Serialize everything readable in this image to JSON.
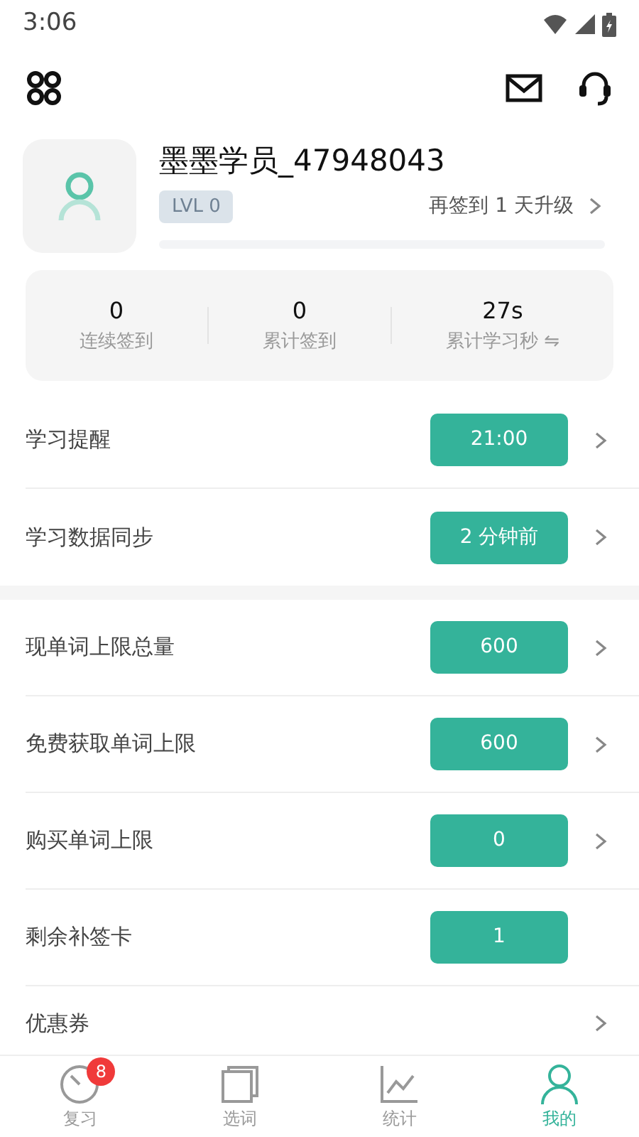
{
  "status_bar": {
    "time": "3:06"
  },
  "profile": {
    "username": "墨墨学员_47948043",
    "level_badge": "LVL 0",
    "upgrade_hint": "再签到 1 天升级"
  },
  "stats": [
    {
      "value": "0",
      "label": "连续签到"
    },
    {
      "value": "0",
      "label": "累计签到"
    },
    {
      "value": "27s",
      "label": "累计学习秒 ⇋"
    }
  ],
  "sections": [
    {
      "rows": [
        {
          "label": "学习提醒",
          "value": "21:00",
          "chevron": true
        },
        {
          "label": "学习数据同步",
          "value": "2 分钟前",
          "chevron": true
        }
      ]
    },
    {
      "rows": [
        {
          "label": "现单词上限总量",
          "value": "600",
          "chevron": true
        },
        {
          "label": "免费获取单词上限",
          "value": "600",
          "chevron": true
        },
        {
          "label": "购买单词上限",
          "value": "0",
          "chevron": true
        },
        {
          "label": "剩余补签卡",
          "value": "1",
          "chevron": false
        },
        {
          "label": "优惠券",
          "chevron": true
        }
      ]
    }
  ],
  "tabs": [
    {
      "label": "复习",
      "selected": false,
      "badge": "8",
      "kind": "clock"
    },
    {
      "label": "选词",
      "selected": false,
      "kind": "cards"
    },
    {
      "label": "统计",
      "selected": false,
      "kind": "chart"
    },
    {
      "label": "我的",
      "selected": true,
      "kind": "person"
    }
  ]
}
